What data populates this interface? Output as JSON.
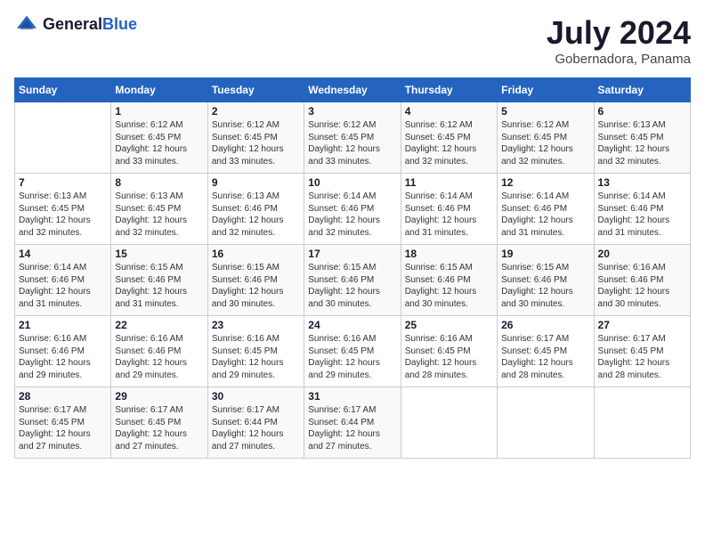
{
  "header": {
    "logo_general": "General",
    "logo_blue": "Blue",
    "month": "July 2024",
    "location": "Gobernadora, Panama"
  },
  "days_of_week": [
    "Sunday",
    "Monday",
    "Tuesday",
    "Wednesday",
    "Thursday",
    "Friday",
    "Saturday"
  ],
  "weeks": [
    [
      {
        "day": "",
        "info": ""
      },
      {
        "day": "1",
        "info": "Sunrise: 6:12 AM\nSunset: 6:45 PM\nDaylight: 12 hours\nand 33 minutes."
      },
      {
        "day": "2",
        "info": "Sunrise: 6:12 AM\nSunset: 6:45 PM\nDaylight: 12 hours\nand 33 minutes."
      },
      {
        "day": "3",
        "info": "Sunrise: 6:12 AM\nSunset: 6:45 PM\nDaylight: 12 hours\nand 33 minutes."
      },
      {
        "day": "4",
        "info": "Sunrise: 6:12 AM\nSunset: 6:45 PM\nDaylight: 12 hours\nand 32 minutes."
      },
      {
        "day": "5",
        "info": "Sunrise: 6:12 AM\nSunset: 6:45 PM\nDaylight: 12 hours\nand 32 minutes."
      },
      {
        "day": "6",
        "info": "Sunrise: 6:13 AM\nSunset: 6:45 PM\nDaylight: 12 hours\nand 32 minutes."
      }
    ],
    [
      {
        "day": "7",
        "info": "Sunrise: 6:13 AM\nSunset: 6:45 PM\nDaylight: 12 hours\nand 32 minutes."
      },
      {
        "day": "8",
        "info": "Sunrise: 6:13 AM\nSunset: 6:45 PM\nDaylight: 12 hours\nand 32 minutes."
      },
      {
        "day": "9",
        "info": "Sunrise: 6:13 AM\nSunset: 6:46 PM\nDaylight: 12 hours\nand 32 minutes."
      },
      {
        "day": "10",
        "info": "Sunrise: 6:14 AM\nSunset: 6:46 PM\nDaylight: 12 hours\nand 32 minutes."
      },
      {
        "day": "11",
        "info": "Sunrise: 6:14 AM\nSunset: 6:46 PM\nDaylight: 12 hours\nand 31 minutes."
      },
      {
        "day": "12",
        "info": "Sunrise: 6:14 AM\nSunset: 6:46 PM\nDaylight: 12 hours\nand 31 minutes."
      },
      {
        "day": "13",
        "info": "Sunrise: 6:14 AM\nSunset: 6:46 PM\nDaylight: 12 hours\nand 31 minutes."
      }
    ],
    [
      {
        "day": "14",
        "info": "Sunrise: 6:14 AM\nSunset: 6:46 PM\nDaylight: 12 hours\nand 31 minutes."
      },
      {
        "day": "15",
        "info": "Sunrise: 6:15 AM\nSunset: 6:46 PM\nDaylight: 12 hours\nand 31 minutes."
      },
      {
        "day": "16",
        "info": "Sunrise: 6:15 AM\nSunset: 6:46 PM\nDaylight: 12 hours\nand 30 minutes."
      },
      {
        "day": "17",
        "info": "Sunrise: 6:15 AM\nSunset: 6:46 PM\nDaylight: 12 hours\nand 30 minutes."
      },
      {
        "day": "18",
        "info": "Sunrise: 6:15 AM\nSunset: 6:46 PM\nDaylight: 12 hours\nand 30 minutes."
      },
      {
        "day": "19",
        "info": "Sunrise: 6:15 AM\nSunset: 6:46 PM\nDaylight: 12 hours\nand 30 minutes."
      },
      {
        "day": "20",
        "info": "Sunrise: 6:16 AM\nSunset: 6:46 PM\nDaylight: 12 hours\nand 30 minutes."
      }
    ],
    [
      {
        "day": "21",
        "info": "Sunrise: 6:16 AM\nSunset: 6:46 PM\nDaylight: 12 hours\nand 29 minutes."
      },
      {
        "day": "22",
        "info": "Sunrise: 6:16 AM\nSunset: 6:46 PM\nDaylight: 12 hours\nand 29 minutes."
      },
      {
        "day": "23",
        "info": "Sunrise: 6:16 AM\nSunset: 6:45 PM\nDaylight: 12 hours\nand 29 minutes."
      },
      {
        "day": "24",
        "info": "Sunrise: 6:16 AM\nSunset: 6:45 PM\nDaylight: 12 hours\nand 29 minutes."
      },
      {
        "day": "25",
        "info": "Sunrise: 6:16 AM\nSunset: 6:45 PM\nDaylight: 12 hours\nand 28 minutes."
      },
      {
        "day": "26",
        "info": "Sunrise: 6:17 AM\nSunset: 6:45 PM\nDaylight: 12 hours\nand 28 minutes."
      },
      {
        "day": "27",
        "info": "Sunrise: 6:17 AM\nSunset: 6:45 PM\nDaylight: 12 hours\nand 28 minutes."
      }
    ],
    [
      {
        "day": "28",
        "info": "Sunrise: 6:17 AM\nSunset: 6:45 PM\nDaylight: 12 hours\nand 27 minutes."
      },
      {
        "day": "29",
        "info": "Sunrise: 6:17 AM\nSunset: 6:45 PM\nDaylight: 12 hours\nand 27 minutes."
      },
      {
        "day": "30",
        "info": "Sunrise: 6:17 AM\nSunset: 6:44 PM\nDaylight: 12 hours\nand 27 minutes."
      },
      {
        "day": "31",
        "info": "Sunrise: 6:17 AM\nSunset: 6:44 PM\nDaylight: 12 hours\nand 27 minutes."
      },
      {
        "day": "",
        "info": ""
      },
      {
        "day": "",
        "info": ""
      },
      {
        "day": "",
        "info": ""
      }
    ]
  ]
}
